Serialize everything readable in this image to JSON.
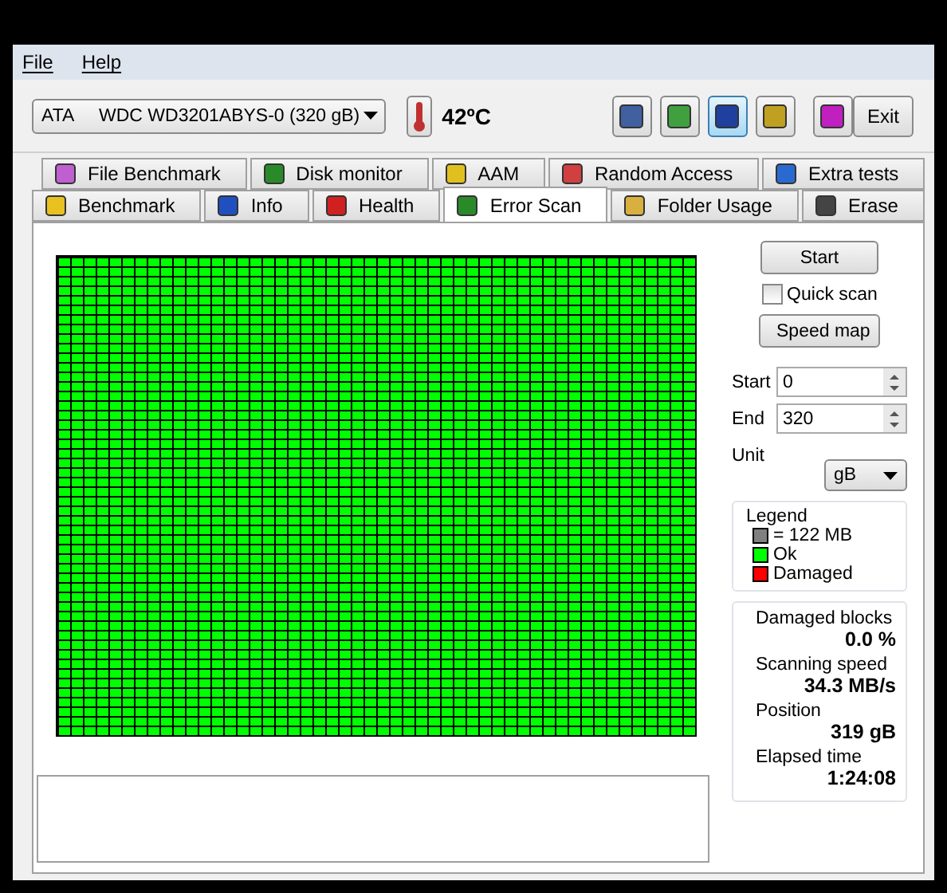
{
  "menu": [
    "File",
    "Help"
  ],
  "toolbar": {
    "drive": "ATA     WDC WD3201ABYS-0 (320 gB)",
    "temperature": "42ºC",
    "exit": "Exit",
    "tool_buttons": [
      {
        "highlighted": false
      },
      {
        "highlighted": false
      },
      {
        "highlighted": true
      },
      {
        "highlighted": false
      },
      {
        "highlighted": false
      }
    ]
  },
  "tab_rows": [
    [
      {
        "label": "File Benchmark",
        "selected": false
      },
      {
        "label": "Disk monitor",
        "selected": false
      },
      {
        "label": "AAM",
        "selected": false
      },
      {
        "label": "Random Access",
        "selected": false
      },
      {
        "label": "Extra tests",
        "selected": false
      }
    ],
    [
      {
        "label": "Benchmark",
        "selected": false
      },
      {
        "label": "Info",
        "selected": false
      },
      {
        "label": "Health",
        "selected": false
      },
      {
        "label": "Error Scan",
        "selected": true
      },
      {
        "label": "Folder Usage",
        "selected": false
      },
      {
        "label": "Erase",
        "selected": false
      }
    ]
  ],
  "scan_map": {
    "all_ok": true
  },
  "controls": {
    "start_button": "Start",
    "quick_scan": {
      "label": "Quick scan",
      "checked": false
    },
    "speed_map_button": "Speed map",
    "start_label": "Start",
    "start_value": "0",
    "end_label": "End",
    "end_value": "320",
    "unit_label": "Unit",
    "unit_value": "gB"
  },
  "legend": {
    "title": "Legend",
    "items": [
      {
        "label": "= 122 MB",
        "color": "#808080"
      },
      {
        "label": "Ok",
        "color": "#00ff00"
      },
      {
        "label": "Damaged",
        "color": "#ff0000"
      }
    ]
  },
  "stats": [
    {
      "label": "Damaged blocks",
      "value": "0.0 %"
    },
    {
      "label": "Scanning speed",
      "value": "34.3 MB/s"
    },
    {
      "label": "Position",
      "value": "319 gB"
    },
    {
      "label": "Elapsed time",
      "value": "1:24:08"
    }
  ]
}
